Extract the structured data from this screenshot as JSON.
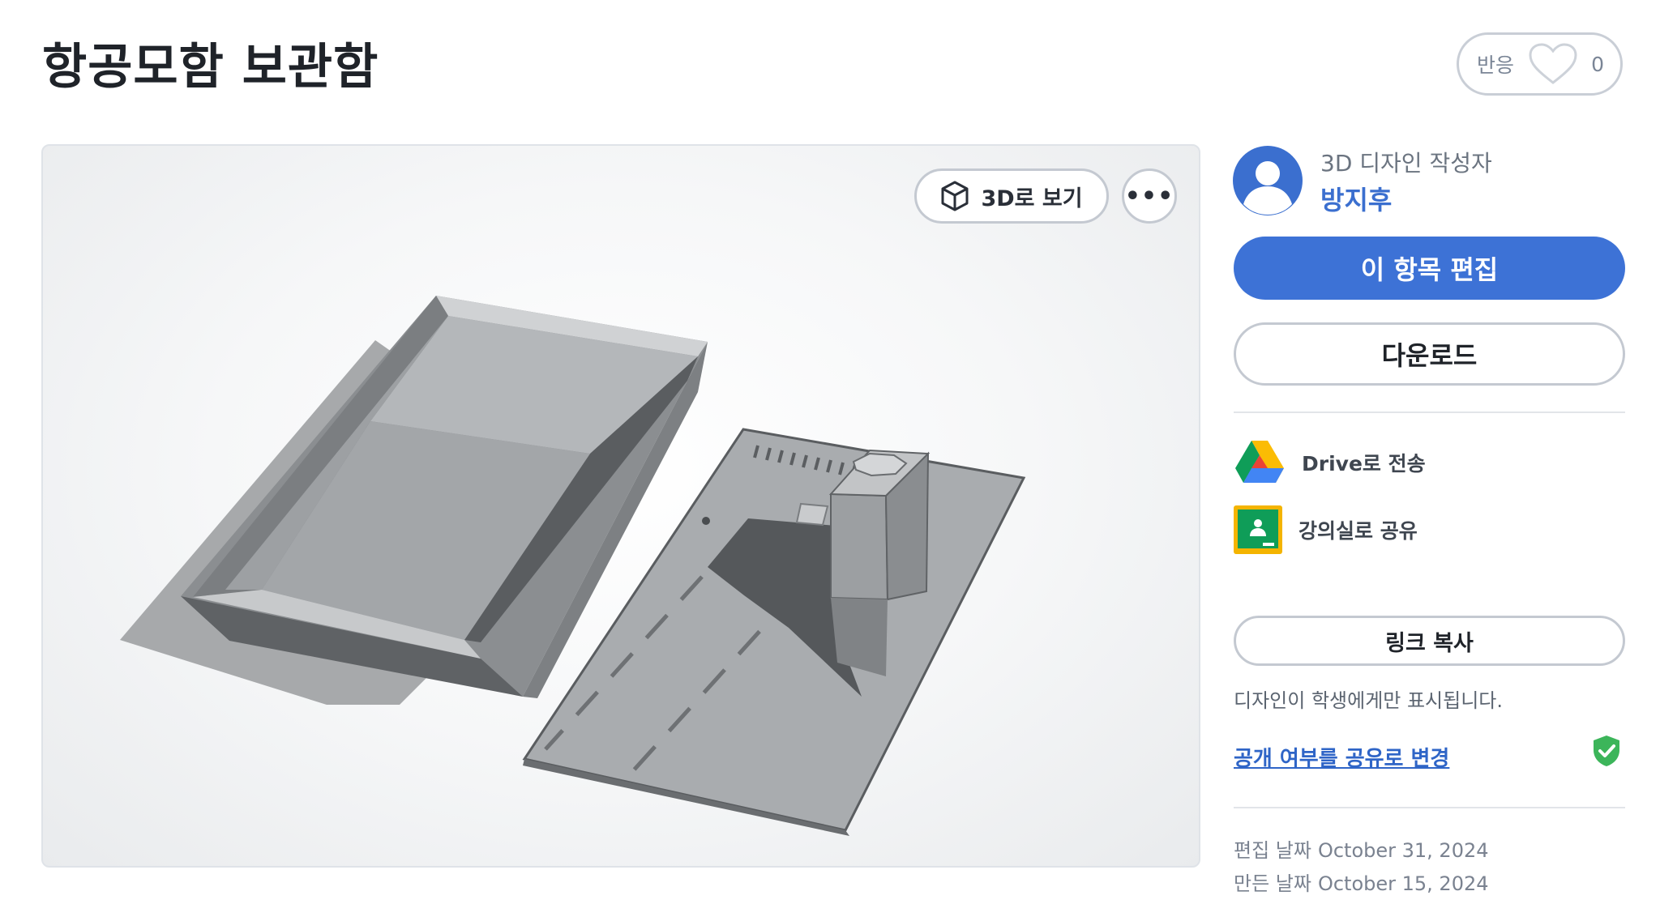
{
  "page": {
    "title": "항공모함 보관함"
  },
  "reaction": {
    "label": "반응",
    "count": "0",
    "icon": "heart-icon"
  },
  "viewer": {
    "view_3d_label": "3D로 보기",
    "view_3d_icon": "cube-icon",
    "more_label": "•••",
    "more_icon": "more-icon"
  },
  "author": {
    "role": "3D 디자인 작성자",
    "name": "방지후",
    "avatar_icon": "user-avatar-icon"
  },
  "actions": {
    "edit_label": "이 항목 편집",
    "download_label": "다운로드"
  },
  "share": {
    "drive_label": "Drive로 전송",
    "drive_icon": "google-drive-icon",
    "classroom_label": "강의실로 공유",
    "classroom_icon": "google-classroom-icon",
    "copy_link_label": "링크 복사",
    "visibility_note": "디자인이 학생에게만 표시됩니다.",
    "change_link": "공개 여부를 공유로 변경",
    "shield_icon": "shield-check-icon"
  },
  "meta": {
    "edited_label": "편집 날짜",
    "edited_date": "October 31, 2024",
    "created_label": "만든 날짜",
    "created_date": "October 15, 2024"
  },
  "colors": {
    "primary": "#3d72d6",
    "link": "#2f65c7",
    "shield": "#3cb55a"
  }
}
